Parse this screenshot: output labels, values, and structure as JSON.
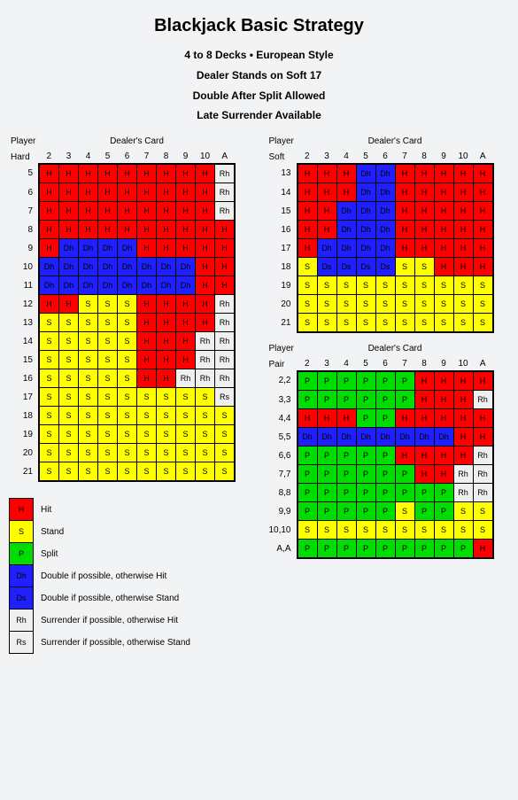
{
  "title": "Blackjack Basic Strategy",
  "subtitles": [
    "4 to 8 Decks • European Style",
    "Dealer Stands on Soft 17",
    "Double After Split Allowed",
    "Late Surrender Available"
  ],
  "labels": {
    "player": "Player",
    "dealer": "Dealer's Card",
    "hard": "Hard",
    "soft": "Soft",
    "pair": "Pair"
  },
  "dealer_cards": [
    "2",
    "3",
    "4",
    "5",
    "6",
    "7",
    "8",
    "9",
    "10",
    "A"
  ],
  "chart_data": {
    "type": "table",
    "title": "Blackjack Basic Strategy",
    "dealer_cards": [
      "2",
      "3",
      "4",
      "5",
      "6",
      "7",
      "8",
      "9",
      "10",
      "A"
    ],
    "codes": {
      "H": "Hit",
      "S": "Stand",
      "P": "Split",
      "Dh": "Double if possible, otherwise Hit",
      "Ds": "Double if possible, otherwise Stand",
      "Rh": "Surrender if possible, otherwise Hit",
      "Rs": "Surrender if possible, otherwise Stand"
    },
    "hard": [
      {
        "hand": "5",
        "cells": [
          "H",
          "H",
          "H",
          "H",
          "H",
          "H",
          "H",
          "H",
          "H",
          "Rh"
        ]
      },
      {
        "hand": "6",
        "cells": [
          "H",
          "H",
          "H",
          "H",
          "H",
          "H",
          "H",
          "H",
          "H",
          "Rh"
        ]
      },
      {
        "hand": "7",
        "cells": [
          "H",
          "H",
          "H",
          "H",
          "H",
          "H",
          "H",
          "H",
          "H",
          "Rh"
        ]
      },
      {
        "hand": "8",
        "cells": [
          "H",
          "H",
          "H",
          "H",
          "H",
          "H",
          "H",
          "H",
          "H",
          "H"
        ]
      },
      {
        "hand": "9",
        "cells": [
          "H",
          "Dh",
          "Dh",
          "Dh",
          "Dh",
          "H",
          "H",
          "H",
          "H",
          "H"
        ]
      },
      {
        "hand": "10",
        "cells": [
          "Dh",
          "Dh",
          "Dh",
          "Dh",
          "Dh",
          "Dh",
          "Dh",
          "Dh",
          "H",
          "H"
        ]
      },
      {
        "hand": "11",
        "cells": [
          "Dh",
          "Dh",
          "Dh",
          "Dh",
          "Dh",
          "Dh",
          "Dh",
          "Dh",
          "H",
          "H"
        ]
      },
      {
        "hand": "12",
        "cells": [
          "H",
          "H",
          "S",
          "S",
          "S",
          "H",
          "H",
          "H",
          "H",
          "Rh"
        ]
      },
      {
        "hand": "13",
        "cells": [
          "S",
          "S",
          "S",
          "S",
          "S",
          "H",
          "H",
          "H",
          "H",
          "Rh"
        ]
      },
      {
        "hand": "14",
        "cells": [
          "S",
          "S",
          "S",
          "S",
          "S",
          "H",
          "H",
          "H",
          "Rh",
          "Rh"
        ]
      },
      {
        "hand": "15",
        "cells": [
          "S",
          "S",
          "S",
          "S",
          "S",
          "H",
          "H",
          "H",
          "Rh",
          "Rh"
        ]
      },
      {
        "hand": "16",
        "cells": [
          "S",
          "S",
          "S",
          "S",
          "S",
          "H",
          "H",
          "Rh",
          "Rh",
          "Rh"
        ]
      },
      {
        "hand": "17",
        "cells": [
          "S",
          "S",
          "S",
          "S",
          "S",
          "S",
          "S",
          "S",
          "S",
          "Rs"
        ]
      },
      {
        "hand": "18",
        "cells": [
          "S",
          "S",
          "S",
          "S",
          "S",
          "S",
          "S",
          "S",
          "S",
          "S"
        ]
      },
      {
        "hand": "19",
        "cells": [
          "S",
          "S",
          "S",
          "S",
          "S",
          "S",
          "S",
          "S",
          "S",
          "S"
        ]
      },
      {
        "hand": "20",
        "cells": [
          "S",
          "S",
          "S",
          "S",
          "S",
          "S",
          "S",
          "S",
          "S",
          "S"
        ]
      },
      {
        "hand": "21",
        "cells": [
          "S",
          "S",
          "S",
          "S",
          "S",
          "S",
          "S",
          "S",
          "S",
          "S"
        ]
      }
    ],
    "soft": [
      {
        "hand": "13",
        "cells": [
          "H",
          "H",
          "H",
          "Dh",
          "Dh",
          "H",
          "H",
          "H",
          "H",
          "H"
        ]
      },
      {
        "hand": "14",
        "cells": [
          "H",
          "H",
          "H",
          "Dh",
          "Dh",
          "H",
          "H",
          "H",
          "H",
          "H"
        ]
      },
      {
        "hand": "15",
        "cells": [
          "H",
          "H",
          "Dh",
          "Dh",
          "Dh",
          "H",
          "H",
          "H",
          "H",
          "H"
        ]
      },
      {
        "hand": "16",
        "cells": [
          "H",
          "H",
          "Dh",
          "Dh",
          "Dh",
          "H",
          "H",
          "H",
          "H",
          "H"
        ]
      },
      {
        "hand": "17",
        "cells": [
          "H",
          "Dh",
          "Dh",
          "Dh",
          "Dh",
          "H",
          "H",
          "H",
          "H",
          "H"
        ]
      },
      {
        "hand": "18",
        "cells": [
          "S",
          "Ds",
          "Ds",
          "Ds",
          "Ds",
          "S",
          "S",
          "H",
          "H",
          "H"
        ]
      },
      {
        "hand": "19",
        "cells": [
          "S",
          "S",
          "S",
          "S",
          "S",
          "S",
          "S",
          "S",
          "S",
          "S"
        ]
      },
      {
        "hand": "20",
        "cells": [
          "S",
          "S",
          "S",
          "S",
          "S",
          "S",
          "S",
          "S",
          "S",
          "S"
        ]
      },
      {
        "hand": "21",
        "cells": [
          "S",
          "S",
          "S",
          "S",
          "S",
          "S",
          "S",
          "S",
          "S",
          "S"
        ]
      }
    ],
    "pair": [
      {
        "hand": "2,2",
        "cells": [
          "P",
          "P",
          "P",
          "P",
          "P",
          "P",
          "H",
          "H",
          "H",
          "H"
        ]
      },
      {
        "hand": "3,3",
        "cells": [
          "P",
          "P",
          "P",
          "P",
          "P",
          "P",
          "H",
          "H",
          "H",
          "Rh"
        ]
      },
      {
        "hand": "4,4",
        "cells": [
          "H",
          "H",
          "H",
          "P",
          "P",
          "H",
          "H",
          "H",
          "H",
          "H"
        ]
      },
      {
        "hand": "5,5",
        "cells": [
          "Dh",
          "Dh",
          "Dh",
          "Dh",
          "Dh",
          "Dh",
          "Dh",
          "Dh",
          "H",
          "H"
        ]
      },
      {
        "hand": "6,6",
        "cells": [
          "P",
          "P",
          "P",
          "P",
          "P",
          "H",
          "H",
          "H",
          "H",
          "Rh"
        ]
      },
      {
        "hand": "7,7",
        "cells": [
          "P",
          "P",
          "P",
          "P",
          "P",
          "P",
          "H",
          "H",
          "Rh",
          "Rh"
        ]
      },
      {
        "hand": "8,8",
        "cells": [
          "P",
          "P",
          "P",
          "P",
          "P",
          "P",
          "P",
          "P",
          "Rh",
          "Rh"
        ]
      },
      {
        "hand": "9,9",
        "cells": [
          "P",
          "P",
          "P",
          "P",
          "P",
          "S",
          "P",
          "P",
          "S",
          "S"
        ]
      },
      {
        "hand": "10,10",
        "cells": [
          "S",
          "S",
          "S",
          "S",
          "S",
          "S",
          "S",
          "S",
          "S",
          "S"
        ]
      },
      {
        "hand": "A,A",
        "cells": [
          "P",
          "P",
          "P",
          "P",
          "P",
          "P",
          "P",
          "P",
          "P",
          "H"
        ]
      }
    ]
  },
  "legend": [
    {
      "code": "H",
      "label": "Hit"
    },
    {
      "code": "S",
      "label": "Stand"
    },
    {
      "code": "P",
      "label": "Split"
    },
    {
      "code": "Dh",
      "label": "Double if possible, otherwise Hit"
    },
    {
      "code": "Ds",
      "label": "Double if possible, otherwise Stand"
    },
    {
      "code": "Rh",
      "label": "Surrender if possible, otherwise Hit"
    },
    {
      "code": "Rs",
      "label": "Surrender if possible, otherwise Stand"
    }
  ]
}
